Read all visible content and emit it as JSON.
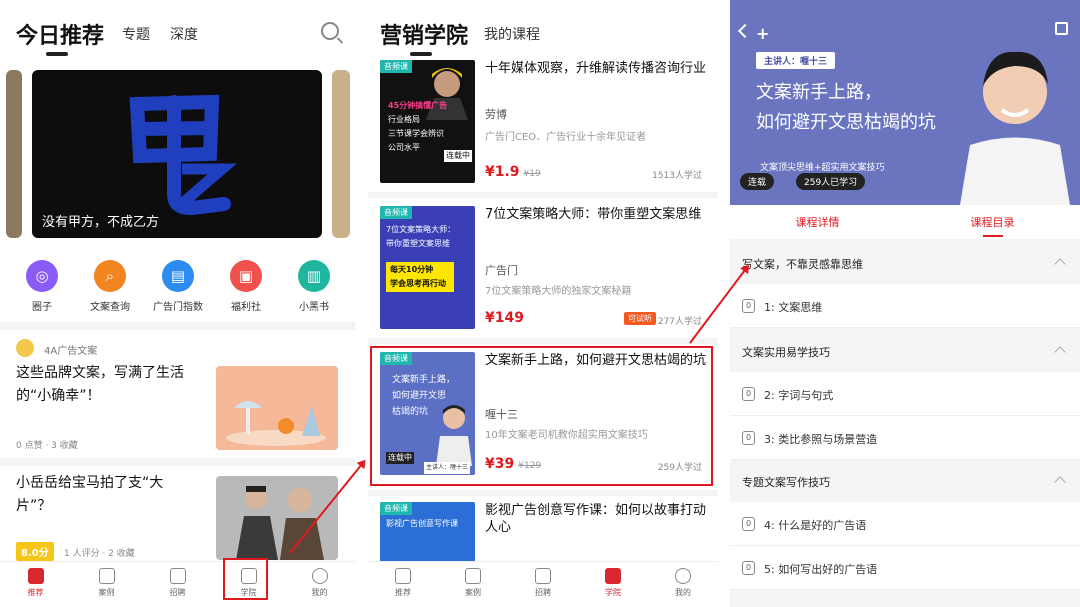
{
  "screen1": {
    "title": "今日推荐",
    "tabs": [
      "专题",
      "深度"
    ],
    "banner_caption": "没有甲方，不成乙方",
    "icons": [
      {
        "label": "圈子",
        "color": "#8a5cf5",
        "icon": "planet-icon"
      },
      {
        "label": "文案查询",
        "color": "#f2851f",
        "icon": "doc-search-icon"
      },
      {
        "label": "广告门指数",
        "color": "#2d8cf0",
        "icon": "chart-icon"
      },
      {
        "label": "福利社",
        "color": "#f0514c",
        "icon": "gift-icon"
      },
      {
        "label": "小黑书",
        "color": "#1fb6a0",
        "icon": "book-icon"
      }
    ],
    "article1": {
      "source": "4A广告文案",
      "title": "这些品牌文案，写满了生活的“小确幸”！",
      "meta": "0 点赞 · 3 收藏"
    },
    "article2": {
      "title": "小岳岳给宝马拍了支“大片”？",
      "score": "8.0分",
      "meta": "1 人评分 · 2 收藏"
    },
    "tabbar": [
      "推荐",
      "案例",
      "招聘",
      "学院",
      "我的"
    ]
  },
  "screen2": {
    "title": "营销学院",
    "tab": "我的课程",
    "courses": [
      {
        "tag": "音频课",
        "title": "十年媒体观察，升维解读传播咨询行业",
        "author": "劳博",
        "desc": "广告门CEO、广告行业十余年见证者",
        "price": "¥1.9",
        "oprice": "¥19",
        "learners": "1513人学过",
        "trial": ""
      },
      {
        "tag": "音频课",
        "title": "7位文案策略大师：带你重塑文案思维",
        "author": "广告门",
        "desc": "7位文案策略大师的独家文案秘籍",
        "price": "¥149",
        "oprice": "",
        "learners": "277人学过",
        "trial": "可试听"
      },
      {
        "tag": "音频课",
        "title": "文案新手上路，如何避开文思枯竭的坑",
        "author": "喱十三",
        "desc": "10年文案老司机教你超实用文案技巧",
        "price": "¥39",
        "oprice": "¥129",
        "learners": "259人学过",
        "trial": ""
      },
      {
        "tag": "音频课",
        "title": "影视广告创意写作课：如何以故事打动人心",
        "author": "",
        "desc": "",
        "price": "",
        "oprice": "",
        "learners": "",
        "trial": ""
      }
    ],
    "thumb1_lines": [
      "45分钟搞懂广告",
      "行业格局",
      "三节课学会辨识",
      "公司水平"
    ],
    "thumb1_badge": "连载中",
    "thumb2_lines": [
      "7位文案策略大师：",
      "带你重塑文案思维",
      "每天10分钟",
      "学会思考再行动"
    ],
    "thumb3_lines": [
      "文案新手上路，",
      "如何避开文思",
      "枯竭的坑"
    ],
    "thumb3_badge": "连载中",
    "thumb3_speaker": "主讲人：喱十三",
    "thumb4_lines": [
      "影视广告创意写作课"
    ],
    "tabbar": [
      "推荐",
      "案例",
      "招聘",
      "学院",
      "我的"
    ]
  },
  "screen3": {
    "speaker": "主讲人：喱十三",
    "title_line1": "文案新手上路，",
    "title_line2": "如何避开文思枯竭的坑",
    "subtitle": "文案顶尖思维+超实用文案技巧",
    "badge1": "连载",
    "badge2": "259人已学习",
    "tabs": [
      "课程详情",
      "课程目录"
    ],
    "chapters": [
      {
        "title": "写文案，不靠灵感靠思维",
        "lessons": [
          {
            "num": "0",
            "title": "1: 文案思维"
          }
        ]
      },
      {
        "title": "文案实用易学技巧",
        "lessons": [
          {
            "num": "0",
            "title": "2: 字词与句式"
          },
          {
            "num": "0",
            "title": "3: 类比参照与场景营造"
          }
        ]
      },
      {
        "title": "专题文案写作技巧",
        "lessons": [
          {
            "num": "0",
            "title": "4: 什么是好的广告语"
          },
          {
            "num": "0",
            "title": "5: 如何写出好的广告语"
          }
        ]
      }
    ]
  },
  "colors": {
    "accent": "#e0191f",
    "teal": "#1fb6b0"
  }
}
